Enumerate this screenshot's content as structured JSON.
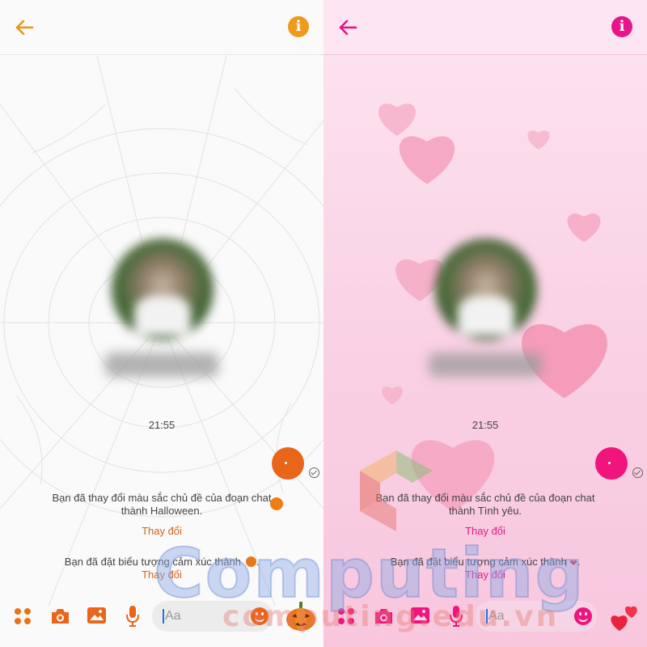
{
  "colors": {
    "halloween_accent": "#e8771a",
    "halloween_link": "#d4631a",
    "love_accent": "#f0147c",
    "love_link": "#e01a8a"
  },
  "left": {
    "theme": "Halloween",
    "time": "21:55",
    "system_message_1": "Bạn đã thay đổi màu sắc chủ đề của đoạn chat thành Halloween.",
    "change_label_1": "Thay đổi",
    "system_message_2": "Bạn đã đặt biểu tượng cảm xúc thành",
    "system_message_2_end": ".",
    "change_label_2": "Thay đổi",
    "input_placeholder": "Aa",
    "icons": [
      "back-arrow",
      "info",
      "apps",
      "camera",
      "photo",
      "microphone",
      "emoji-smile",
      "pumpkin-reaction"
    ]
  },
  "right": {
    "theme": "Tình yêu",
    "time": "21:55",
    "system_message_1": "Bạn đã thay đổi màu sắc chủ đề của đoạn chat thành Tình yêu.",
    "change_label_1": "Thay đổi",
    "system_message_2": "Bạn đã đặt biểu tượng cảm xúc thành",
    "system_message_2_end": ".",
    "change_label_2": "Thay đổi",
    "input_placeholder": "Aa",
    "icons": [
      "back-arrow",
      "info",
      "apps",
      "camera",
      "photo",
      "microphone",
      "emoji-smile",
      "hearts-reaction"
    ]
  },
  "watermark": {
    "main": "Computing",
    "sub": "computing.edu.vn"
  }
}
